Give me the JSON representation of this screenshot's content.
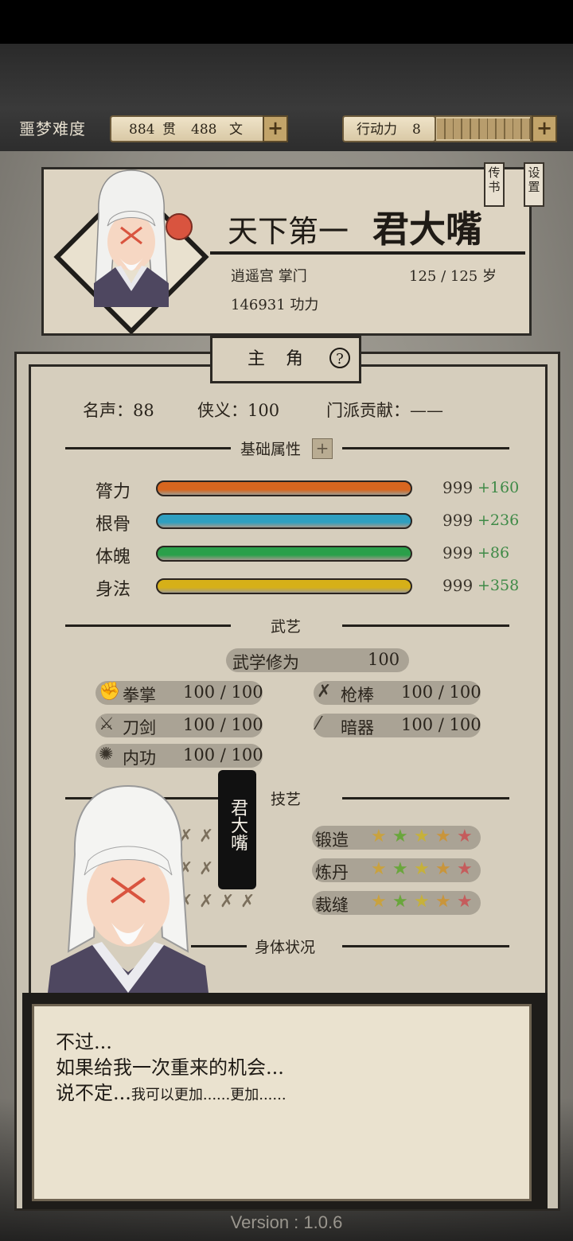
{
  "top": {
    "difficulty": "噩梦难度",
    "money_guan": "884",
    "guan_unit": "贯",
    "money_wen": "488",
    "wen_unit": "文",
    "action_label": "行动力",
    "action_value": "8",
    "action_fill": 0.0
  },
  "header": {
    "title_prefix": "天下第一",
    "name": "君大嘴",
    "sect": "逍遥宫 掌门",
    "age": "125 / 125 岁",
    "power": "146931 功力",
    "tab_letters": "传书",
    "tab_settings": "设置"
  },
  "tab": {
    "label": "主角",
    "help": "?"
  },
  "stats": {
    "fame": "名声：88",
    "justice": "侠义：100",
    "contribution": "门派贡献：——"
  },
  "sections": {
    "base": "基础属性",
    "martial": "武艺",
    "craft": "技艺",
    "body": "身体状况"
  },
  "attributes": [
    {
      "label": "膂力",
      "value": "999",
      "bonus": "+160",
      "color": "#d8661f"
    },
    {
      "label": "根骨",
      "value": "999",
      "bonus": "+236",
      "color": "#2f9fc0"
    },
    {
      "label": "体魄",
      "value": "999",
      "bonus": "+86",
      "color": "#2aa04a"
    },
    {
      "label": "身法",
      "value": "999",
      "bonus": "+358",
      "color": "#d6b018"
    }
  ],
  "martial": {
    "study_label": "武学修为",
    "study_value": "100",
    "skills": [
      {
        "name": "拳掌",
        "value": "100 / 100",
        "icon": "fist-icon"
      },
      {
        "name": "枪棒",
        "value": "100 / 100",
        "icon": "spear-icon"
      },
      {
        "name": "刀剑",
        "value": "100 / 100",
        "icon": "swords-icon"
      },
      {
        "name": "暗器",
        "value": "100 / 100",
        "icon": "dart-icon"
      },
      {
        "name": "内功",
        "value": "100 / 100",
        "icon": "energy-icon"
      }
    ]
  },
  "crafts": [
    {
      "name": "锻造",
      "stars": 5,
      "icon": "anvil-icon"
    },
    {
      "name": "炼丹",
      "stars": 5,
      "icon": "bowl-icon"
    },
    {
      "name": "裁缝",
      "stars": 5,
      "icon": "needle-icon"
    }
  ],
  "speaker": "君大嘴",
  "dialog": {
    "line1": "不过...",
    "line2": "如果给我一次重来的机会...",
    "line3a": "说不定...",
    "line3b": "我可以更加......更加......"
  },
  "version": "Version : 1.0.6",
  "colors": {
    "paper": "#d6cebd",
    "ink": "#23201b",
    "bonus": "#3f8a47"
  }
}
